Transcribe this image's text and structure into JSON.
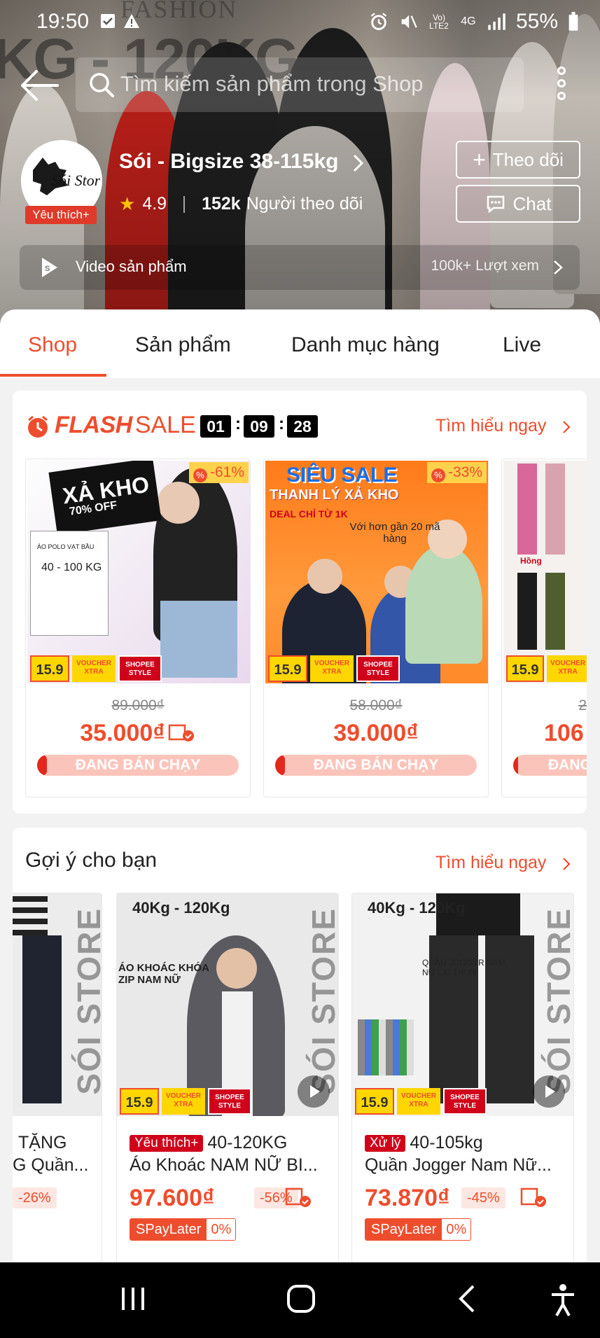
{
  "status_bar": {
    "time": "19:50",
    "battery": "55%",
    "network": "4G",
    "volte": "Vo) LTE2"
  },
  "search": {
    "placeholder": "Tìm kiếm sản phẩm trong Shop"
  },
  "hero_text": {
    "big": "KG - 120KG",
    "fashion": "FASHION"
  },
  "shop": {
    "name": "Sói - Bigsize 38-115kg",
    "badge": "Yêu thích+",
    "rating": "4.9",
    "followers_count": "152k",
    "followers_label": "Người theo dõi",
    "follow_label": "Theo dõi",
    "chat_label": "Chat",
    "avatar_text": "Sói Store"
  },
  "video": {
    "label": "Video sản phẩm",
    "views": "100k+ Lượt xem"
  },
  "tabs": [
    {
      "label": "Shop"
    },
    {
      "label": "Sản phẩm"
    },
    {
      "label": "Danh mục hàng"
    },
    {
      "label": "Live"
    }
  ],
  "flash_sale": {
    "title_a": "FLASH",
    "title_b": "SALE",
    "countdown": [
      "01",
      "09",
      "28"
    ],
    "learn_more": "Tìm hiểu ngay",
    "products": [
      {
        "discount": "-61%",
        "old_price": "89.000₫",
        "price": "35.000₫",
        "status": "ĐANG BÁN CHẠY",
        "sold_fraction": 0.05,
        "img_title": "XẢ KHO",
        "img_sub": "70% OFF",
        "img_size": "40 - 100 KG",
        "img_name": "ÁO POLO VẠT BẦU"
      },
      {
        "discount": "-33%",
        "old_price": "58.000₫",
        "price": "39.000₫",
        "status": "ĐANG BÁN CHẠY",
        "sold_fraction": 0.05,
        "img_title": "SIÊU SALE",
        "img_sub": "THANH LÝ XẢ KHO",
        "img_deal": "DEAL CHỈ TỪ 1K",
        "img_more": "Với hơn gần 20 mã hàng"
      },
      {
        "discount": "",
        "old_price": "2",
        "price": "106",
        "status": "ĐANG",
        "sold_fraction": 0.05,
        "img_title": "Hồng"
      }
    ],
    "tag_159": "15.9",
    "tag_voucher": "VOUCHER XTRA",
    "tag_shopee": "SHOPEE STYLE"
  },
  "suggestions": {
    "title": "Gợi ý cho bạn",
    "learn_more": "Tìm hiểu ngay",
    "store_watermark": "SÓI STORE",
    "items": [
      {
        "line1": "TẶNG",
        "line2": "G Quần...",
        "discount": "-26%"
      },
      {
        "badge": "Yêu thích+",
        "line1": "40-120KG",
        "line2": "Áo Khoác NAM NỮ BI...",
        "price": "97.600₫",
        "discount": "-56%",
        "spaylater": "SPayLater",
        "spl_rate": "0%",
        "img_kg": "40Kg - 120Kg",
        "img_name": "ÁO KHOÁC KHÓA ZIP NAM NỮ"
      },
      {
        "badge": "Xử lý",
        "line1": "40-105kg",
        "line2": "Quần Jogger Nam Nữ...",
        "price": "73.870₫",
        "discount": "-45%",
        "spaylater": "SPayLater",
        "spl_rate": "0%",
        "img_kg": "40Kg - 120Kg",
        "img_name": "QUẦN JOGGER NAM NỮ LẠI THUN"
      }
    ]
  }
}
